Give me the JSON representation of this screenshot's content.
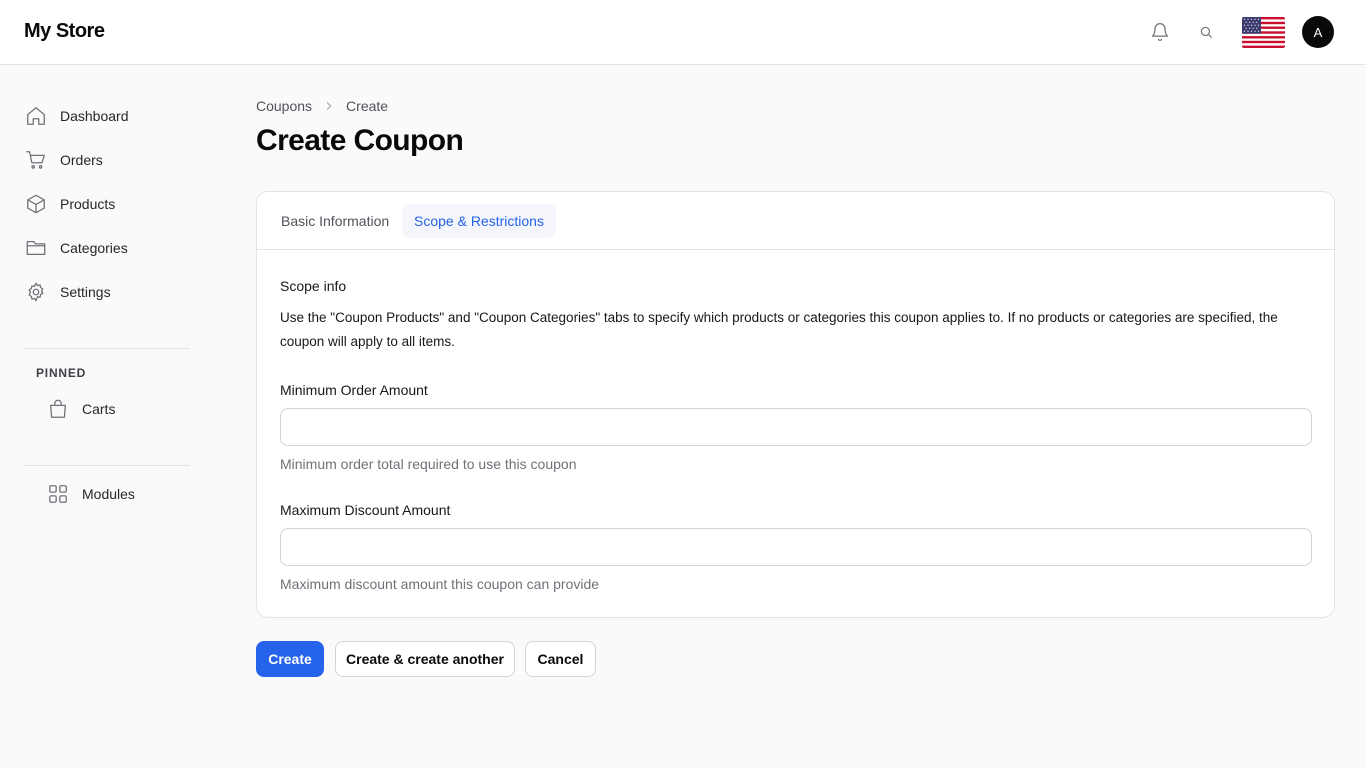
{
  "app": {
    "brand": "My Store"
  },
  "header": {
    "notifications_icon": "bell-icon",
    "search_icon": "search-icon",
    "locale_flag": "us-flag",
    "avatar_initial": "A"
  },
  "sidebar": {
    "items": [
      {
        "label": "Dashboard",
        "icon": "home-icon"
      },
      {
        "label": "Orders",
        "icon": "cart-icon"
      },
      {
        "label": "Products",
        "icon": "box-icon"
      },
      {
        "label": "Categories",
        "icon": "folder-icon"
      },
      {
        "label": "Settings",
        "icon": "gear-icon"
      }
    ],
    "pinned_label": "PINNED",
    "pinned": [
      {
        "label": "Carts",
        "icon": "bag-icon"
      }
    ],
    "extra": [
      {
        "label": "Modules",
        "icon": "grid-icon"
      }
    ]
  },
  "breadcrumb": {
    "parent": "Coupons",
    "current": "Create"
  },
  "page": {
    "title": "Create Coupon"
  },
  "tabs": [
    {
      "label": "Basic Information",
      "active": false
    },
    {
      "label": "Scope & Restrictions",
      "active": true
    }
  ],
  "scope": {
    "heading": "Scope info",
    "text": "Use the \"Coupon Products\" and \"Coupon Categories\" tabs to specify which products or categories this coupon applies to. If no products or categories are specified, the coupon will apply to all items."
  },
  "fields": {
    "min_order": {
      "label": "Minimum Order Amount",
      "value": "",
      "placeholder": "",
      "helper": "Minimum order total required to use this coupon"
    },
    "max_discount": {
      "label": "Maximum Discount Amount",
      "value": "",
      "placeholder": "",
      "helper": "Maximum discount amount this coupon can provide"
    }
  },
  "actions": {
    "create": "Create",
    "create_another": "Create & create another",
    "cancel": "Cancel"
  },
  "colors": {
    "accent": "#2563eb",
    "background": "#fafafa",
    "border": "#e4e4e7",
    "active_tab_bg": "#f4f6fb"
  }
}
